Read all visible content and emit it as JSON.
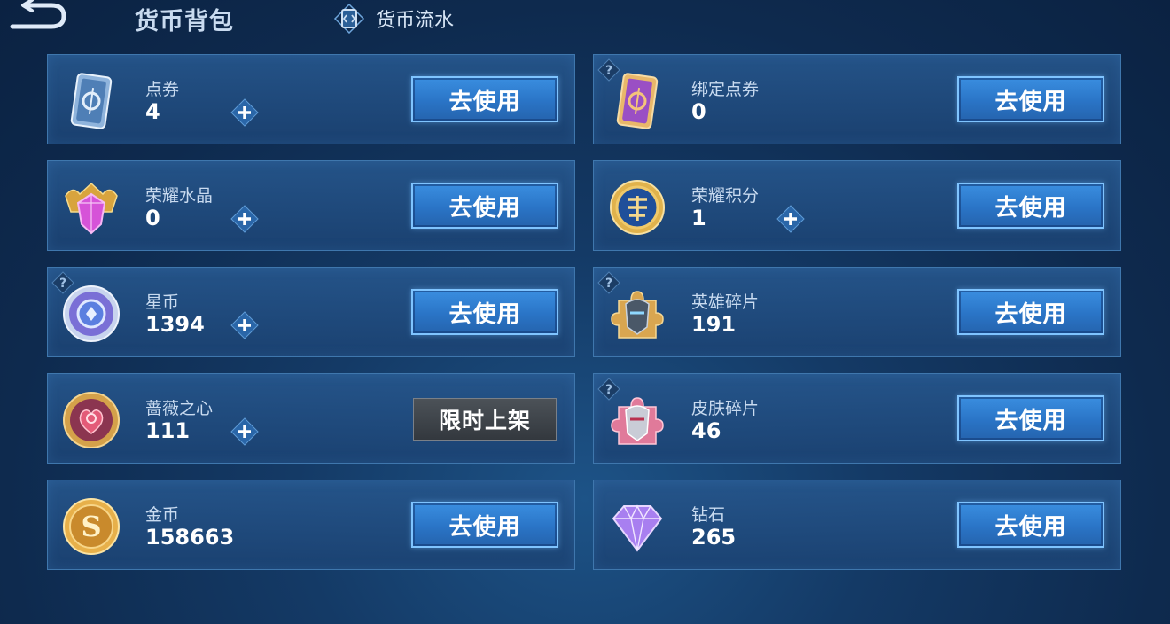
{
  "header": {
    "title": "货币背包",
    "flow_label": "货币流水"
  },
  "colors": {
    "button_blue": "#2a74c6",
    "button_border": "#7fc4ff",
    "card_border": "#3f77ad",
    "disabled_gray": "#3f454b"
  },
  "currencies": [
    {
      "name": "点券",
      "amount": "4",
      "icon": "voucher-card-icon",
      "has_plus": true,
      "has_help": false,
      "action": "去使用"
    },
    {
      "name": "绑定点券",
      "amount": "0",
      "icon": "bound-voucher-card-icon",
      "has_plus": false,
      "has_help": true,
      "action": "去使用"
    },
    {
      "name": "荣耀水晶",
      "amount": "0",
      "icon": "glory-crystal-icon",
      "has_plus": true,
      "has_help": false,
      "action": "去使用"
    },
    {
      "name": "荣耀积分",
      "amount": "1",
      "icon": "glory-points-icon",
      "has_plus": true,
      "has_help": false,
      "action": "去使用"
    },
    {
      "name": "星币",
      "amount": "1394",
      "icon": "star-coin-icon",
      "has_plus": true,
      "has_help": true,
      "action": "去使用"
    },
    {
      "name": "英雄碎片",
      "amount": "191",
      "icon": "hero-fragment-icon",
      "has_plus": false,
      "has_help": true,
      "action": "去使用"
    },
    {
      "name": "蔷薇之心",
      "amount": "111",
      "icon": "rose-heart-icon",
      "has_plus": true,
      "has_help": false,
      "action": "限时上架"
    },
    {
      "name": "皮肤碎片",
      "amount": "46",
      "icon": "skin-fragment-icon",
      "has_plus": false,
      "has_help": true,
      "action": "去使用"
    },
    {
      "name": "金币",
      "amount": "158663",
      "icon": "gold-coin-icon",
      "has_plus": false,
      "has_help": false,
      "action": "去使用"
    },
    {
      "name": "钻石",
      "amount": "265",
      "icon": "diamond-icon",
      "has_plus": false,
      "has_help": false,
      "action": "去使用"
    }
  ]
}
